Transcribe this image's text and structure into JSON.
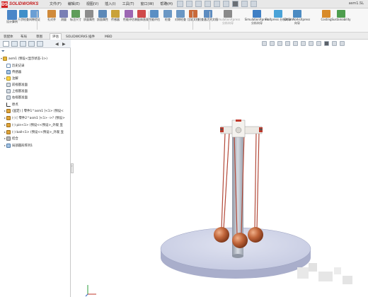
{
  "app": {
    "logo_mark": "DS",
    "logo_text": "SOLIDWORKS",
    "document_title": "asm1.SL"
  },
  "menu": [
    "文件(F)",
    "编辑(E)",
    "视图(V)",
    "插入(I)",
    "工具(T)",
    "窗口(W)",
    "帮助(H)"
  ],
  "commands": [
    {
      "label": "设计算例",
      "color": "#4a86c8"
    },
    {
      "label": "干涉检查",
      "color": "#3f8fc9"
    },
    {
      "label": "间隙验证",
      "color": "#6b9fd4"
    },
    {
      "label": "孔对齐",
      "color": "#d08a3a"
    },
    {
      "label": "测量",
      "color": "#7a7fb5"
    },
    {
      "label": "标注尺寸",
      "color": "#5f9d5a"
    },
    {
      "label": "质量属性",
      "color": "#8d8d8d"
    },
    {
      "label": "剖面属性",
      "color": "#5c89b8"
    },
    {
      "label": "传感器",
      "color": "#c9a23a"
    },
    {
      "label": "性能评估",
      "color": "#9c66b3"
    },
    {
      "label": "装配体直观",
      "color": "#d04a4a"
    },
    {
      "label": "性能评估",
      "color": "#5a8fc4"
    },
    {
      "label": "检查",
      "color": "#6a97c4"
    },
    {
      "label": "对称检查",
      "color": "#6a97c4"
    },
    {
      "label": "比较文档",
      "color": "#c96a3a"
    },
    {
      "label": "检查激活的文档",
      "color": "#5d8cc0"
    },
    {
      "label": "SimulationXpress 分析向导",
      "color": "#8a8a8a"
    },
    {
      "label": "SimulationXpress 分析向导",
      "color": "#3f7fc4"
    },
    {
      "label": "FloXpress 分析向导",
      "color": "#4aa3d8"
    },
    {
      "label": "DriveWorksXpress 向导",
      "color": "#4c8bc2"
    },
    {
      "label": "Costing",
      "color": "#d88b2a"
    },
    {
      "label": "Sustainability",
      "color": "#4e9e4e"
    }
  ],
  "tabs": [
    "装配体",
    "布局",
    "草图",
    "评估",
    "SOLIDWORKS 插件",
    "MBD"
  ],
  "active_tab_index": 3,
  "tree": [
    {
      "label": "asm1 (预设<显示状态-1>)",
      "icon": "assembly-icon",
      "level": 0,
      "expander": "▾"
    },
    {
      "label": "历史记录",
      "icon": "history-icon",
      "level": 1,
      "expander": ""
    },
    {
      "label": "传感器",
      "icon": "sensor-icon",
      "level": 1,
      "expander": ""
    },
    {
      "label": "注解",
      "icon": "annotation-icon",
      "level": 1,
      "expander": "▸"
    },
    {
      "label": "前视基准面",
      "icon": "plane-icon",
      "level": 1,
      "expander": ""
    },
    {
      "label": "上视基准面",
      "icon": "plane-icon",
      "level": 1,
      "expander": ""
    },
    {
      "label": "右视基准面",
      "icon": "plane-icon",
      "level": 1,
      "expander": ""
    },
    {
      "label": "原点",
      "icon": "origin-icon",
      "level": 1,
      "expander": ""
    },
    {
      "label": "(固定) [ 零件1^asm1 ]<1> (预设<",
      "icon": "part-icon",
      "level": 1,
      "expander": "▸"
    },
    {
      "label": "(-) [ 零件2^asm1 ]<1> ->? (预设>",
      "icon": "part-icon",
      "level": 1,
      "expander": "▸"
    },
    {
      "label": "(-) pin<1> (预设<<预设>_外观 显",
      "icon": "part-icon",
      "level": 1,
      "expander": "▸"
    },
    {
      "label": "(-) ball<1> (预设<<预设>_外观 显",
      "icon": "part-icon",
      "level": 1,
      "expander": "▸"
    },
    {
      "label": "结合",
      "icon": "mate-icon",
      "level": 1,
      "expander": "▸"
    },
    {
      "label": "局部圆形阵列1",
      "icon": "pattern-icon",
      "level": 1,
      "expander": "▸"
    }
  ],
  "colors": {
    "rod": "#a9b0bb",
    "base_top": "#cfd2e6",
    "base_side": "#b0b5d0",
    "ball": "#c0653a",
    "string": "#b34a3a",
    "hub": "#e9e7e3",
    "hub_accent": "#c0392b"
  }
}
